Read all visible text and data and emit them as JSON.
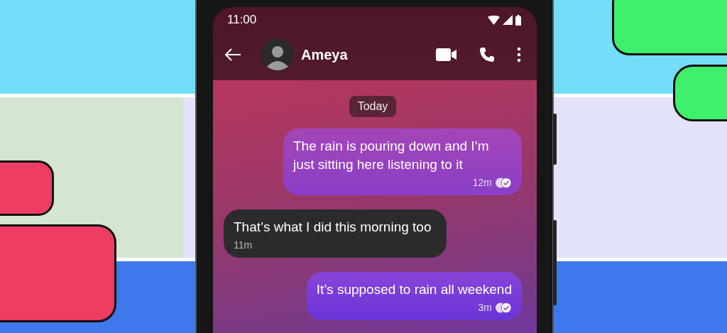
{
  "status_bar": {
    "time": "11:00"
  },
  "header": {
    "contact_name": "Ameya"
  },
  "date_chip": "Today",
  "messages": [
    {
      "kind": "sent",
      "text": "The rain is pouring down and I’m just sitting here listening to it",
      "time": "12m",
      "read": true
    },
    {
      "kind": "received",
      "text": "That’s what I did this morning too",
      "time": "11m"
    },
    {
      "kind": "sent",
      "text": "It’s supposed to rain all weekend",
      "time": "3m",
      "read": true
    }
  ]
}
